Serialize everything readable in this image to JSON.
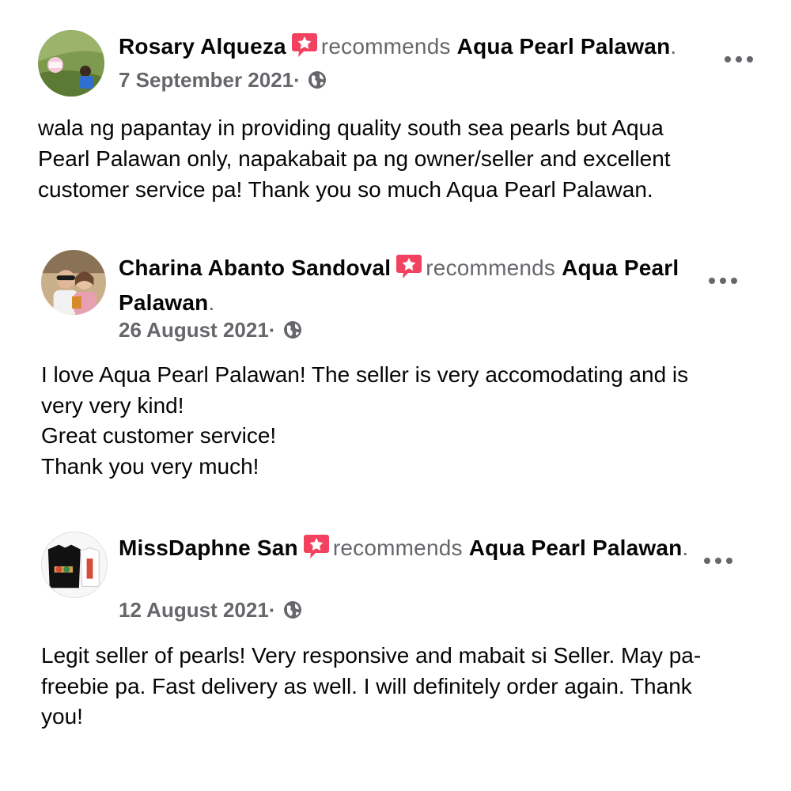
{
  "reviews": [
    {
      "author": "Rosary Alqueza",
      "action": "recommends",
      "page": "Aqua Pearl Palawan",
      "date": "7 September 2021",
      "text": "wala ng papantay in providing quality south sea pearls but Aqua\nPearl Palawan only,  napakabait  pa ng owner/seller and excellent\ncustomer service pa!  Thank you so much Aqua Pearl Palawan."
    },
    {
      "author": "Charina Abanto Sandoval",
      "action": "recommends",
      "page": "Aqua Pearl Palawan",
      "date": "26 August 2021",
      "text": "I love Aqua Pearl Palawan! The seller is very accomodating and is\nvery very kind!\nGreat customer service!\nThank you very much!"
    },
    {
      "author": "MissDaphne San",
      "action": "recommends",
      "page": "Aqua Pearl Palawan",
      "date": "12 August 2021",
      "text": "Legit seller of pearls! Very responsive and mabait si Seller. May pa-\nfreebie pa. Fast delivery as well. I will definitely order again. Thank\nyou!"
    }
  ],
  "punctuation": {
    "period": ".",
    "date_separator": "·"
  },
  "icons": {
    "recommend": "recommend-star-icon",
    "privacy": "globe-icon",
    "more": "more-options-icon"
  },
  "colors": {
    "recommend_badge": "#f3425f",
    "secondary_text": "#65676b",
    "primary_text": "#050505"
  }
}
